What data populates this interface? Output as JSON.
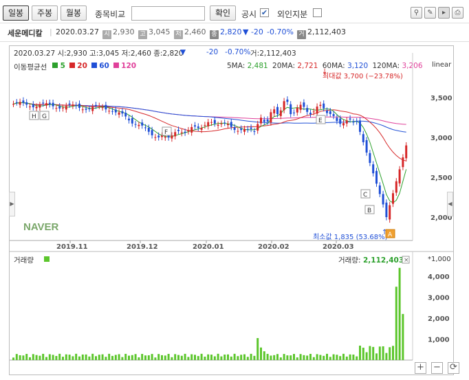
{
  "toolbar": {
    "period_buttons": [
      "일봉",
      "주봉",
      "월봉"
    ],
    "compare_label": "종목비교",
    "confirm_label": "확인",
    "disclosure_label": "공시",
    "foreign_label": "외인지분"
  },
  "info": {
    "name": "세운메디칼",
    "date": "2020.03.27",
    "open_tag": "시",
    "open": "2,930",
    "high_tag": "고",
    "high": "3,045",
    "low_tag": "저",
    "low": "2,460",
    "close_tag": "종",
    "close": "2,820",
    "change": "▼ -20",
    "change_pct": "-0.70%",
    "vol_tag": "거",
    "volume": "2,112,403"
  },
  "chart": {
    "header_line": "2020.03.27 시:2,930 고:3,045 저:2,460 종:2,820",
    "header_arrow": "▼",
    "header_change": "-20   -0.70%",
    "header_vol": "거:2,112,403",
    "ma_title": "이동평균선",
    "ma_legend": [
      {
        "label": "5",
        "color": "#2ca02c"
      },
      {
        "label": "20",
        "color": "#d62728"
      },
      {
        "label": "60",
        "color": "#1f4fd6"
      },
      {
        "label": "120",
        "color": "#e0409a"
      }
    ],
    "ma_values": [
      {
        "label": "5MA:",
        "value": "2,481",
        "color": "#2ca02c"
      },
      {
        "label": "20MA:",
        "value": "2,721",
        "color": "#d62728"
      },
      {
        "label": "60MA:",
        "value": "3,120",
        "color": "#1f4fd6"
      },
      {
        "label": "120MA:",
        "value": "3,206",
        "color": "#e0409a"
      }
    ],
    "scale_label": "linear",
    "max_label": "최대값 3,700 (−23.78%)",
    "min_label": "최소값 1,835 (53.68%)",
    "watermark": "NAVER",
    "x_ticks": [
      "2019.11",
      "2019.12",
      "2020.01",
      "2020.02",
      "2020.03"
    ],
    "y_ticks": [
      "3,500",
      "3,000",
      "2,500",
      "2,000"
    ],
    "markers": [
      "H",
      "G",
      "F",
      "E",
      "C",
      "B",
      "A"
    ],
    "volume_title": "거래량",
    "volume_value_label": "거래량:",
    "volume_value": "2,112,403",
    "volume_unit": "*1,000",
    "volume_y_ticks": [
      "4,000",
      "3,000",
      "2,000",
      "1,000"
    ]
  },
  "colors": {
    "up": "#d62728",
    "down": "#1f4fd6",
    "volume": "#5cc62c"
  }
}
